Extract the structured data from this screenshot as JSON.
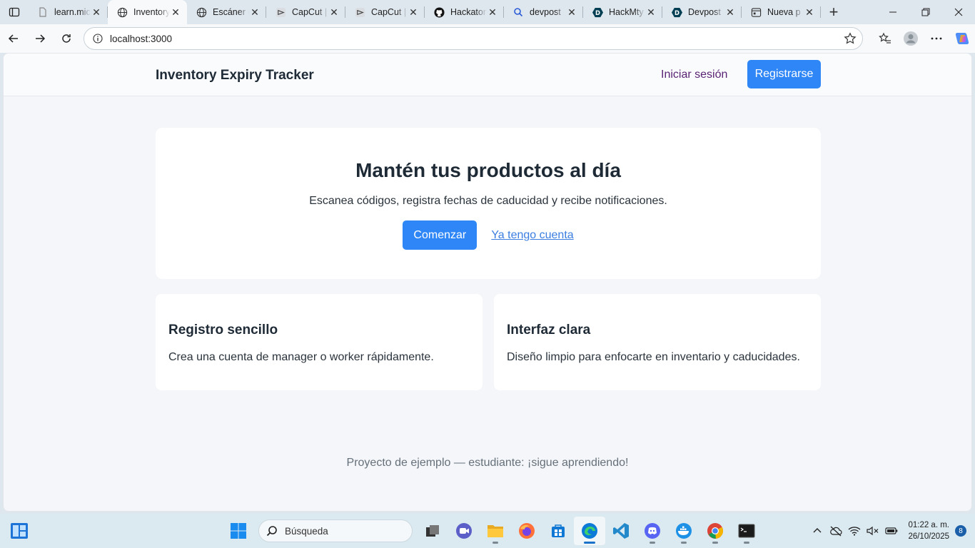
{
  "browser": {
    "tabs": [
      {
        "title": "learn.mic",
        "icon": "document-icon",
        "active": false
      },
      {
        "title": "Inventory",
        "icon": "globe-icon",
        "active": true
      },
      {
        "title": "Escáner d",
        "icon": "globe-icon",
        "active": false
      },
      {
        "title": "CapCut |",
        "icon": "capcut-icon",
        "active": false
      },
      {
        "title": "CapCut |",
        "icon": "capcut-icon",
        "active": false
      },
      {
        "title": "Hackaton",
        "icon": "github-icon",
        "active": false
      },
      {
        "title": "devpost",
        "icon": "search-icon",
        "active": false
      },
      {
        "title": "HackMty",
        "icon": "devpost-icon",
        "active": false
      },
      {
        "title": "Devpost",
        "icon": "devpost-icon",
        "active": false
      },
      {
        "title": "Nueva p",
        "icon": "newtab-page-icon",
        "active": false
      }
    ],
    "address": "localhost:3000"
  },
  "app": {
    "brand": "Inventory Expiry Tracker",
    "nav": {
      "login": "Iniciar sesión",
      "register": "Registrarse"
    },
    "hero": {
      "title": "Mantén tus productos al día",
      "subtitle": "Escanea códigos, registra fechas de caducidad y recibe notificaciones.",
      "primary_cta": "Comenzar",
      "secondary_cta": "Ya tengo cuenta"
    },
    "features": [
      {
        "title": "Registro sencillo",
        "text": "Crea una cuenta de manager o worker rápidamente."
      },
      {
        "title": "Interfaz clara",
        "text": "Diseño limpio para enfocarte en inventario y caducidades."
      }
    ],
    "footer": "Proyecto de ejemplo — estudiante: ¡sigue aprendiendo!"
  },
  "taskbar": {
    "search_placeholder": "Búsqueda",
    "time": "01:22 a. m.",
    "date": "26/10/2025",
    "notifications": "8"
  },
  "colors": {
    "accent": "#2f86f6",
    "brand_text": "#1e2a36",
    "login_link": "#5a2474"
  }
}
